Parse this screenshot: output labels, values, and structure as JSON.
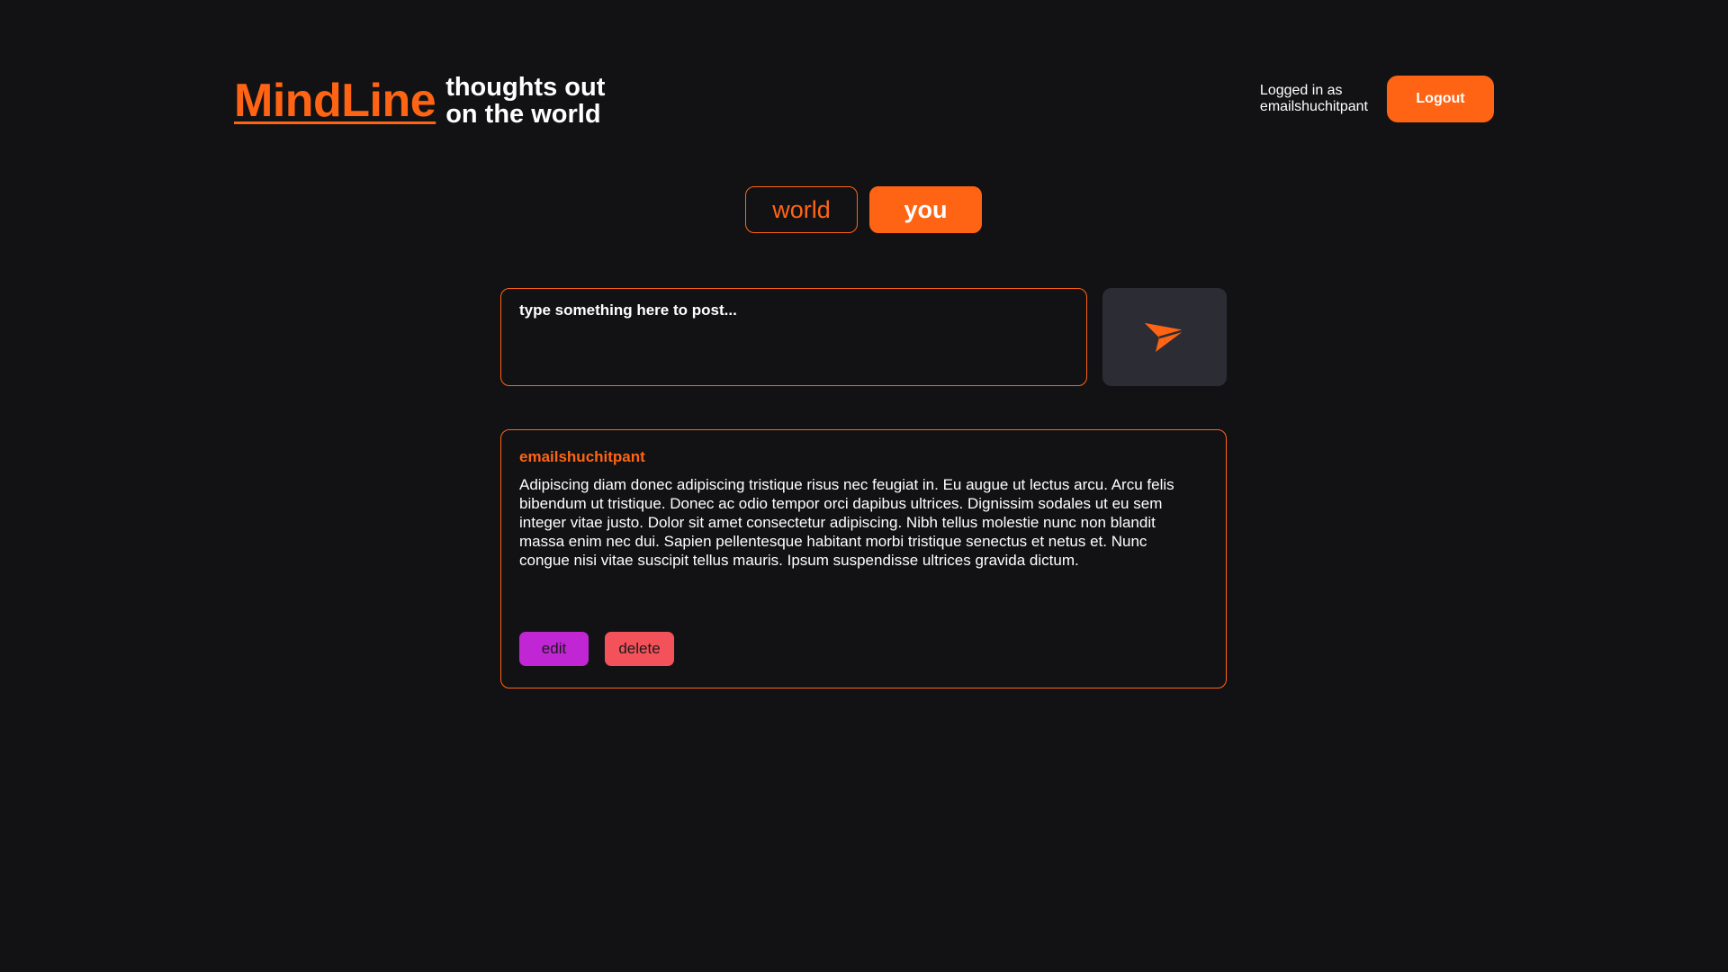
{
  "header": {
    "brand_name": "MindLine",
    "tagline_line1": "thoughts out",
    "tagline_line2": "on the world",
    "logged_in_label": "Logged in as",
    "username": "emailshuchitpant",
    "logout_label": "Logout"
  },
  "tabs": [
    {
      "label": "world",
      "active": false
    },
    {
      "label": "you",
      "active": true
    }
  ],
  "composer": {
    "placeholder": "type something here to post...",
    "value": "",
    "send_icon": "paper-plane-icon"
  },
  "posts": [
    {
      "author": "emailshuchitpant",
      "body": "Adipiscing diam donec adipiscing tristique risus nec feugiat in. Eu augue ut lectus arcu. Arcu felis bibendum ut tristique. Donec ac odio tempor orci dapibus ultrices. Dignissim sodales ut eu sem integer vitae justo. Dolor sit amet consectetur adipiscing. Nibh tellus molestie nunc non blandit massa enim nec dui. Sapien pellentesque habitant morbi tristique senectus et netus et. Nunc congue nisi vitae suscipit tellus mauris. Ipsum suspendisse ultrices gravida dictum.",
      "edit_label": "edit",
      "delete_label": "delete"
    }
  ],
  "colors": {
    "background": "#121214",
    "accent": "#ff6414",
    "send_button_bg": "#2c2d34",
    "edit": "#c026d3",
    "delete": "#f4525a"
  }
}
